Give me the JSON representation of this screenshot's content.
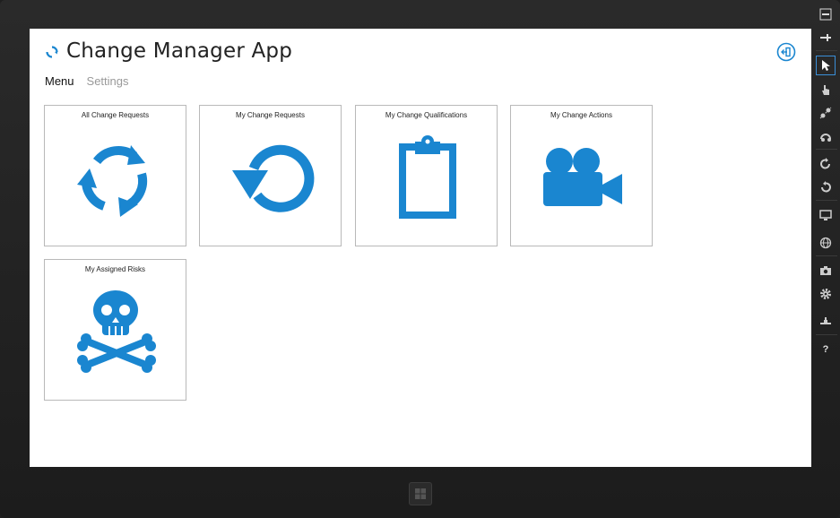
{
  "app": {
    "title": "Change Manager App",
    "accent_color": "#1a86d0"
  },
  "nav": {
    "tabs": [
      {
        "label": "Menu",
        "active": true
      },
      {
        "label": "Settings",
        "active": false
      }
    ]
  },
  "tiles": [
    {
      "label": "All Change Requests",
      "icon": "refresh-arrows-icon"
    },
    {
      "label": "My Change Requests",
      "icon": "undo-circle-icon"
    },
    {
      "label": "My Change Qualifications",
      "icon": "clipboard-icon"
    },
    {
      "label": "My Change Actions",
      "icon": "video-camera-icon"
    },
    {
      "label": "My Assigned Risks",
      "icon": "skull-crossbones-icon"
    }
  ],
  "sidebar": {
    "buttons": [
      "minimize-icon",
      "pin-icon",
      "pointer-icon",
      "hand-icon",
      "pinch-icon",
      "rotate-touch-icon",
      "rotate-clockwise-icon",
      "rotate-counterclockwise-icon",
      "monitor-icon",
      "globe-icon",
      "camera-icon",
      "gear-icon",
      "network-icon",
      "help-icon"
    ],
    "active": "pointer-icon",
    "help_label": "?"
  }
}
